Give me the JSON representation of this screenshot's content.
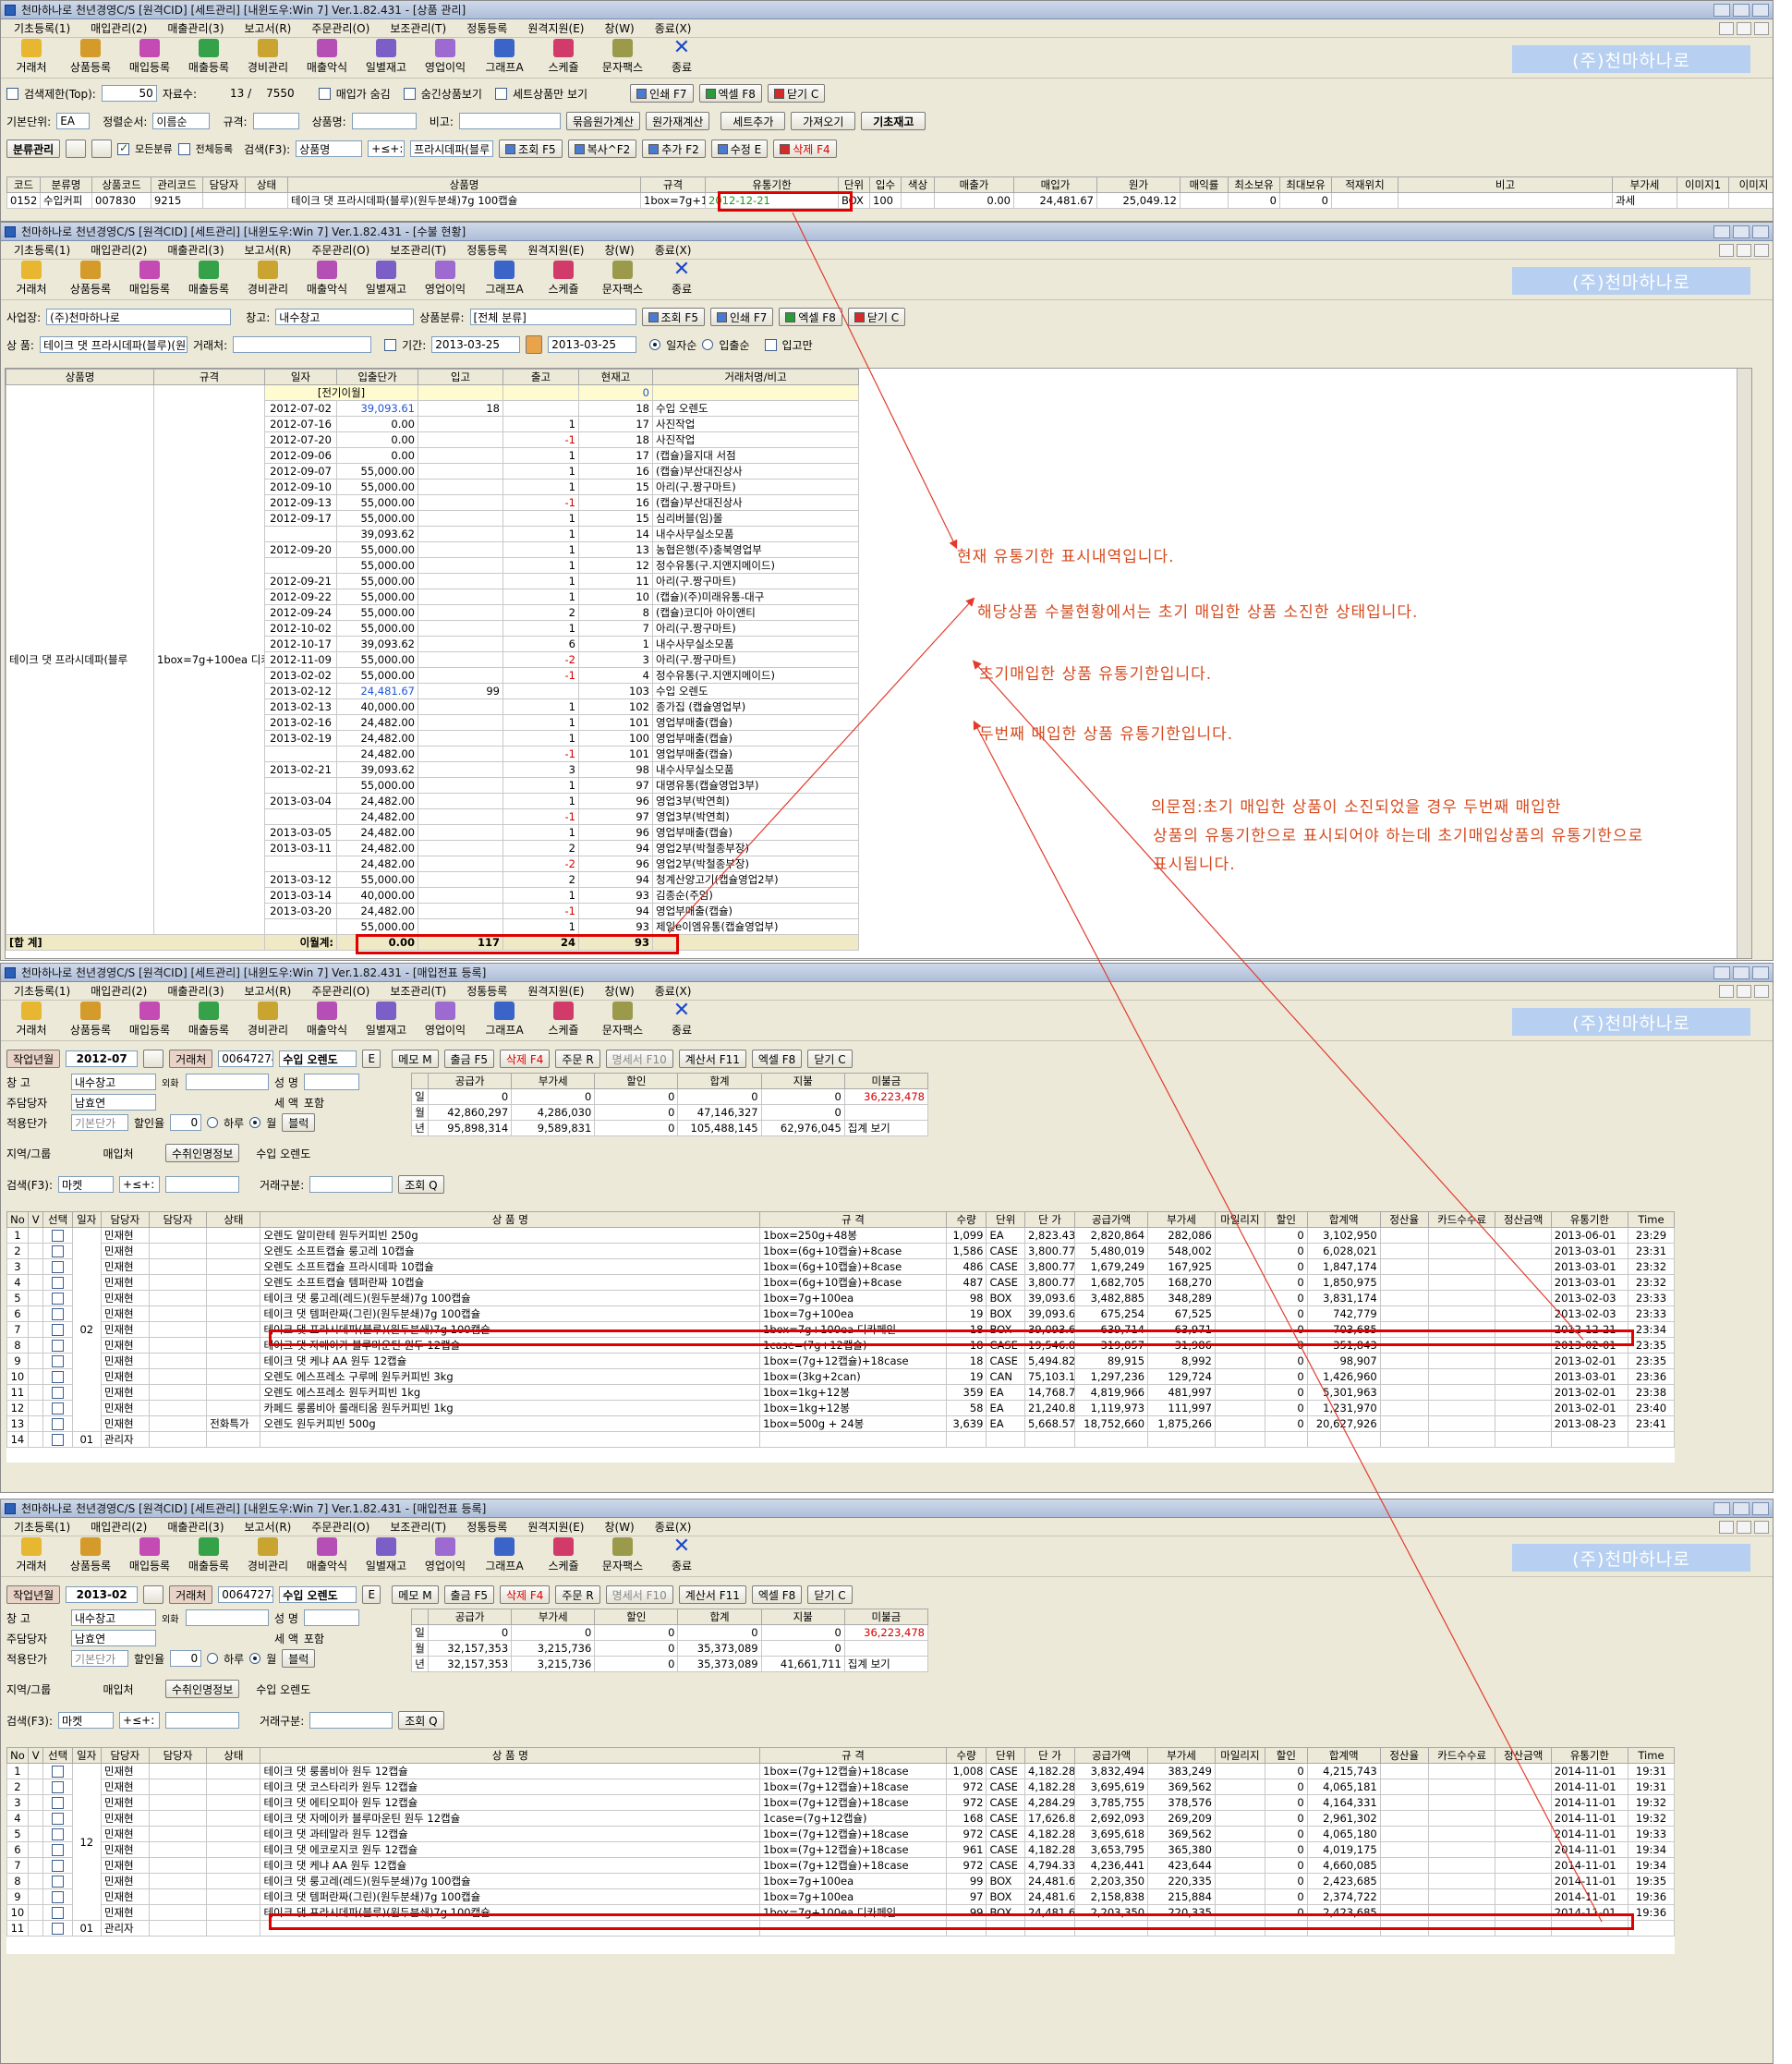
{
  "brand": "(주)천마하나로",
  "menu": [
    "기초등록(1)",
    "매입관리(2)",
    "매출관리(3)",
    "보고서(R)",
    "주문관리(O)",
    "보조관리(T)",
    "정통등록",
    "원격지원(E)",
    "창(W)",
    "종료(X)"
  ],
  "toolbar": [
    "거래처",
    "상품등록",
    "매입등록",
    "매출등록",
    "경비관리",
    "매출악식",
    "일별재고",
    "영업이익",
    "그래프A",
    "스케쥴",
    "문자팩스",
    "종료"
  ],
  "win1": {
    "title": "천마하나로 천년경영C/S [원격CID] [세트관리] [내윈도우:Win 7] Ver.1.82.431 - [상품 관리]",
    "search_limit_label": "검색제한(Top):",
    "search_limit": "50",
    "record_label": "자료수:",
    "record_count": "13 /",
    "record_total": "7550",
    "opt1": "매입가 숨김",
    "opt2": "숨긴상품보기",
    "opt3": "세트상품만 보기",
    "btn_print": "인쇄 F7",
    "btn_excel": "엑셀 F8",
    "btn_close": "닫기 C",
    "unit_label": "기본단위:",
    "unit": "EA",
    "sort_label": "정렬순서:",
    "sort": "이름순",
    "spec_label": "규격:",
    "name_label": "상품명:",
    "memo_label": "비고:",
    "btn_bulk_price": "묶음원가계산",
    "btn_cost_calc": "원가재계산",
    "btn_set_add": "세트추가",
    "btn_fetch": "가져오기",
    "btn_base_stock": "기초재고",
    "btn_category": "분류관리",
    "all_cat": "모든분류",
    "all_reg": "전체등록",
    "search_label": "검색(F3):",
    "search_field": "상품명",
    "search_op": "+≤+:",
    "search_value": "프라시데파(블루",
    "btn_query": "조회 F5",
    "btn_copy": "복사^F2",
    "btn_add": "추가 F2",
    "btn_edit": "수정 E",
    "btn_delete": "삭제 F4",
    "columns": [
      "코드",
      "분류명",
      "상품코드",
      "관리코드",
      "담당자",
      "상태",
      "상품명",
      "규격",
      "유통기한",
      "단위",
      "입수",
      "색상",
      "매출가",
      "매입가",
      "원가",
      "매익률",
      "최소보유",
      "최대보유",
      "적재위치",
      "비고",
      "부가세",
      "이미지1",
      "이미지"
    ],
    "row": [
      "0152",
      "수입커피",
      "007830",
      "9215",
      "",
      "",
      "테이크 댓 프라시데파(블루)(원두분쇄)7g 100캡슐",
      "1box=7g+100ea",
      "2012-12-21",
      "BOX",
      "100",
      "",
      "0.00",
      "24,481.67",
      "25,049.12",
      "",
      "0",
      "0",
      "",
      "",
      "과세",
      "",
      ""
    ]
  },
  "win2": {
    "title": "천마하나로 천년경영C/S [원격CID] [세트관리] [내윈도우:Win 7] Ver.1.82.431 - [수불 현황]",
    "biz_label": "사업장:",
    "biz": "(주)천마하나로",
    "wh_label": "창고:",
    "wh": "내수창고",
    "cat_label": "상품분류:",
    "cat": "[전체 분류]",
    "btn_query": "조회 F5",
    "btn_print": "인쇄 F7",
    "btn_excel": "엑셀 F8",
    "btn_close": "닫기 C",
    "prod_label": "상 품:",
    "prod": "테이크 댓 프라시데파(블루)(원두분",
    "vendor_label": "거래처:",
    "period_label": "기간:",
    "date_from": "2013-03-25",
    "date_to": "2013-03-25",
    "r1": "일자순",
    "r2": "입출순",
    "only_in": "입고만",
    "columns": [
      "상품명",
      "규격",
      "일자",
      "입출단가",
      "입고",
      "출고",
      "현재고",
      "거래처명/비고"
    ],
    "product_name": "테이크 댓 프라시데파(블루",
    "product_spec": "1box=7g+100ea 디카",
    "carry_label": "[전기이월]",
    "carry_value": "0",
    "rows": [
      [
        "2012-07-02",
        "39,093.61",
        "18",
        "",
        "18",
        "수입 오렌도"
      ],
      [
        "2012-07-16",
        "0.00",
        "",
        "1",
        "17",
        "사진작업"
      ],
      [
        "2012-07-20",
        "0.00",
        "",
        "-1",
        "18",
        "사진작업"
      ],
      [
        "2012-09-06",
        "0.00",
        "",
        "1",
        "17",
        "(캡슐)을지대 서점"
      ],
      [
        "2012-09-07",
        "55,000.00",
        "",
        "1",
        "16",
        "(캡슐)부산대진상사"
      ],
      [
        "2012-09-10",
        "55,000.00",
        "",
        "1",
        "15",
        "아리(구.짱구마트)"
      ],
      [
        "2012-09-13",
        "55,000.00",
        "",
        "-1",
        "16",
        "(캡슐)부산대진상사"
      ],
      [
        "2012-09-17",
        "55,000.00",
        "",
        "1",
        "15",
        "심리버블(임)몰"
      ],
      [
        "",
        "39,093.62",
        "",
        "1",
        "14",
        "내수사무실소모품"
      ],
      [
        "2012-09-20",
        "55,000.00",
        "",
        "1",
        "13",
        "농협은행(주)충북영업부"
      ],
      [
        "",
        "55,000.00",
        "",
        "1",
        "12",
        "정수유통(구.지앤지메이드)"
      ],
      [
        "2012-09-21",
        "55,000.00",
        "",
        "1",
        "11",
        "아리(구.짱구마트)"
      ],
      [
        "2012-09-22",
        "55,000.00",
        "",
        "1",
        "10",
        "(캡슐)(주)미래유통-대구"
      ],
      [
        "2012-09-24",
        "55,000.00",
        "",
        "2",
        "8",
        "(캡슐)코디아 아이앤티"
      ],
      [
        "2012-10-02",
        "55,000.00",
        "",
        "1",
        "7",
        "아리(구.짱구마트)"
      ],
      [
        "2012-10-17",
        "39,093.62",
        "",
        "6",
        "1",
        "내수사무실소모품"
      ],
      [
        "2012-11-09",
        "55,000.00",
        "",
        "-2",
        "3",
        "아리(구.짱구마트)"
      ],
      [
        "2013-02-02",
        "55,000.00",
        "",
        "-1",
        "4",
        "정수유통(구.지앤지메이드)"
      ],
      [
        "2013-02-12",
        "24,481.67",
        "99",
        "",
        "103",
        "수입 오렌도"
      ],
      [
        "2013-02-13",
        "40,000.00",
        "",
        "1",
        "102",
        "종가집 (캡슐영업부)"
      ],
      [
        "2013-02-16",
        "24,482.00",
        "",
        "1",
        "101",
        "영업부매출(캡슐)"
      ],
      [
        "2013-02-19",
        "24,482.00",
        "",
        "1",
        "100",
        "영업부매출(캡슐)"
      ],
      [
        "",
        "24,482.00",
        "",
        "-1",
        "101",
        "영업부매출(캡슐)"
      ],
      [
        "2013-02-21",
        "39,093.62",
        "",
        "3",
        "98",
        "내수사무실소모품"
      ],
      [
        "",
        "55,000.00",
        "",
        "1",
        "97",
        "대명유통(캡슐영업3부)"
      ],
      [
        "2013-03-04",
        "24,482.00",
        "",
        "1",
        "96",
        "영업3부(박연희)"
      ],
      [
        "",
        "24,482.00",
        "",
        "-1",
        "97",
        "영업3부(박연희)"
      ],
      [
        "2013-03-05",
        "24,482.00",
        "",
        "1",
        "96",
        "영업부매출(캡슐)"
      ],
      [
        "2013-03-11",
        "24,482.00",
        "",
        "2",
        "94",
        "영업2부(박철종부장)"
      ],
      [
        "",
        "24,482.00",
        "",
        "-2",
        "96",
        "영업2부(박철종부장)"
      ],
      [
        "2013-03-12",
        "55,000.00",
        "",
        "2",
        "94",
        "청계산양고기(캡슐영업2부)"
      ],
      [
        "2013-03-14",
        "40,000.00",
        "",
        "1",
        "93",
        "김종순(주임)"
      ],
      [
        "2013-03-20",
        "24,482.00",
        "",
        "-1",
        "94",
        "영업부매출(캡슐)"
      ],
      [
        "",
        "55,000.00",
        "",
        "1",
        "93",
        "제일e이엠유통(캡슐영업부)"
      ]
    ],
    "total_label": "[합 계]",
    "total_sub_label": "이월계:",
    "total_price": "0.00",
    "total_in": "117",
    "total_out": "24",
    "total_stock": "93"
  },
  "annotations": [
    "현재 유통기한 표시내역입니다.",
    "해당상품 수불현황에서는 초기 매입한 상품 소진한 상태입니다.",
    "초기매입한 상품 유통기한입니다.",
    "두번째 매입한 상품 유통기한입니다.",
    "의문점:초기 매입한 상품이 소진되었을 경우 두번째 매입한",
    "상품의 유통기한으로 표시되어야 하는데 초기매입상품의 유통기한으로",
    "표시됩니다."
  ],
  "win3": {
    "title": "천마하나로 천년경영C/S [원격CID] [세트관리] [내윈도우:Win 7] Ver.1.82.431 - [매입전표 등록]",
    "month_label": "작업년월",
    "month": "2012-07",
    "vendor_label": "거래처",
    "vendor_code": "00647274",
    "vendor_name": "수입 오렌도",
    "e_btn": "E",
    "btn_memo": "메모 M",
    "btn_out": "출금 F5",
    "btn_delete": "삭제 F4",
    "btn_order": "주문 R",
    "btn_stmt": "명세서 F10",
    "btn_bill": "계산서 F11",
    "btn_excel": "엑셀 F8",
    "btn_close": "닫기 C",
    "wh_label": "창 고",
    "wh": "내수창고",
    "staff_label": "주담당자",
    "staff": "남효연",
    "apply_label": "적용단가",
    "apply": "기본단가",
    "disc_label": "할인율",
    "disc": "0",
    "foreign": "외화",
    "name_lbl": "성 명",
    "tax_lbl": "세 액",
    "incl_lbl": "포함",
    "daily": "하루",
    "monthly": "월",
    "btn_block": "블럭",
    "sum_cols": [
      "공급가",
      "부가세",
      "할인",
      "합계",
      "지불",
      "미불금"
    ],
    "sum_rows": [
      {
        "k": "일",
        "v": [
          "0",
          "0",
          "0",
          "0",
          "0",
          ""
        ]
      },
      {
        "k": "월",
        "v": [
          "42,860,297",
          "4,286,030",
          "0",
          "47,146,327",
          "0",
          ""
        ]
      },
      {
        "k": "년",
        "v": [
          "95,898,314",
          "9,589,831",
          "0",
          "105,488,145",
          "62,976,045",
          "집계 보기"
        ]
      }
    ],
    "unpaid": "36,223,478",
    "region_label": "지역/그룹",
    "buyer_label": "매입처",
    "info_label": "수취인명정보",
    "info_value": "수입 오렌도",
    "search_label": "검색(F3):",
    "search_field": "마켓",
    "search_op": "+≤+:",
    "deal_label": "거래구분:",
    "btn_query": "조회 Q",
    "columns": [
      "No",
      "V",
      "선택",
      "일자",
      "담당자",
      "담당자",
      "상태",
      "상 품 명",
      "규 격",
      "수량",
      "단위",
      "단 가",
      "공급가액",
      "부가세",
      "마일리지",
      "할인",
      "합계액",
      "정산율",
      "카드수수료",
      "정산금액",
      "유통기한",
      "Time"
    ],
    "day": "02",
    "rows": [
      [
        "1",
        "민재현",
        "",
        "오렌도 알미란테 원두커피빈 250g",
        "1box=250g+48봉",
        "1,099",
        "EA",
        "2,823.43",
        "2,820,864",
        "282,086",
        "",
        "0",
        "3,102,950",
        "",
        "",
        "",
        "2013-06-01",
        "23:29"
      ],
      [
        "2",
        "민재현",
        "",
        "오렌도 소프트캡슐 룽고레 10캡슐",
        "1box=(6g+10캡슐)+8case",
        "1,586",
        "CASE",
        "3,800.77",
        "5,480,019",
        "548,002",
        "",
        "0",
        "6,028,021",
        "",
        "",
        "",
        "2013-03-01",
        "23:31"
      ],
      [
        "3",
        "민재현",
        "",
        "오렌도 소프트캡슐 프라시데파 10캡슐",
        "1box=(6g+10캡슐)+8case",
        "486",
        "CASE",
        "3,800.77",
        "1,679,249",
        "167,925",
        "",
        "0",
        "1,847,174",
        "",
        "",
        "",
        "2013-03-01",
        "23:32"
      ],
      [
        "4",
        "민재현",
        "",
        "오렌도 소프트캡슐 템퍼란짜 10캡슐",
        "1box=(6g+10캡슐)+8case",
        "487",
        "CASE",
        "3,800.77",
        "1,682,705",
        "168,270",
        "",
        "0",
        "1,850,975",
        "",
        "",
        "",
        "2013-03-01",
        "23:32"
      ],
      [
        "5",
        "민재현",
        "",
        "테이크 댓 룽고레(레드)(원두분쇄)7g 100캡슐",
        "1box=7g+100ea",
        "98",
        "BOX",
        "39,093.61",
        "3,482,885",
        "348,289",
        "",
        "0",
        "3,831,174",
        "",
        "",
        "",
        "2013-02-03",
        "23:33"
      ],
      [
        "6",
        "민재현",
        "",
        "테이크 댓 템퍼란짜(그린)(원두분쇄)7g 100캡슐",
        "1box=7g+100ea",
        "19",
        "BOX",
        "39,093.61",
        "675,254",
        "67,525",
        "",
        "0",
        "742,779",
        "",
        "",
        "",
        "2013-02-03",
        "23:33"
      ],
      [
        "7",
        "민재현",
        "",
        "테이크 댓 프라시데파(블루)(원두분쇄)7g 100캡슐",
        "1box=7g+100ea 디카페인",
        "18",
        "BOX",
        "39,093.61",
        "639,714",
        "63,971",
        "",
        "0",
        "703,685",
        "",
        "",
        "",
        "2012-12-21",
        "23:34"
      ],
      [
        "8",
        "민재현",
        "",
        "테이크 댓 자메이카 블루마운틴 원두 12캡슐",
        "1case=(7g+12캡슐)",
        "18",
        "CASE",
        "19,546.81",
        "319,857",
        "31,986",
        "",
        "0",
        "351,843",
        "",
        "",
        "",
        "2013-02-01",
        "23:35"
      ],
      [
        "9",
        "민재현",
        "",
        "테이크 댓 케냐 AA 원두 12캡슐",
        "1box=(7g+12캡슐)+18case",
        "18",
        "CASE",
        "5,494.82",
        "89,915",
        "8,992",
        "",
        "0",
        "98,907",
        "",
        "",
        "",
        "2013-02-01",
        "23:35"
      ],
      [
        "10",
        "민재현",
        "",
        "오렌도 에스프레소 구루메 원두커피빈 3kg",
        "1box=(3kg+2can)",
        "19",
        "CAN",
        "75,103.17",
        "1,297,236",
        "129,724",
        "",
        "0",
        "1,426,960",
        "",
        "",
        "",
        "2013-03-01",
        "23:36"
      ],
      [
        "11",
        "민재현",
        "",
        "오렌도 에스프레소 원두커피빈 1kg",
        "1box=1kg+12봉",
        "359",
        "EA",
        "14,768.70",
        "4,819,966",
        "481,997",
        "",
        "0",
        "5,301,963",
        "",
        "",
        "",
        "2013-02-01",
        "23:38"
      ],
      [
        "12",
        "민재현",
        "",
        "카페드 룽롬비아 룰래티움 원두커피빈 1kg",
        "1box=1kg+12봉",
        "58",
        "EA",
        "21,240.86",
        "1,119,973",
        "111,997",
        "",
        "0",
        "1,231,970",
        "",
        "",
        "",
        "2013-02-01",
        "23:40"
      ],
      [
        "13",
        "민재현",
        "전화특가",
        "오렌도 원두커피빈 500g",
        "1box=500g + 24봉",
        "3,639",
        "EA",
        "5,668.57",
        "18,752,660",
        "1,875,266",
        "",
        "0",
        "20,627,926",
        "",
        "",
        "",
        "2013-08-23",
        "23:41"
      ]
    ],
    "row14": [
      "14",
      "01",
      "관리자"
    ]
  },
  "win4": {
    "title": "천마하나로 천년경영C/S [원격CID] [세트관리] [내윈도우:Win 7] Ver.1.82.431 - [매입전표 등록]",
    "month": "2013-02",
    "vendor_code": "00647274",
    "vendor_name": "수입 오렌도",
    "sum_rows": [
      {
        "k": "일",
        "v": [
          "0",
          "0",
          "0",
          "0",
          "0",
          ""
        ]
      },
      {
        "k": "월",
        "v": [
          "32,157,353",
          "3,215,736",
          "0",
          "35,373,089",
          "0",
          ""
        ]
      },
      {
        "k": "년",
        "v": [
          "32,157,353",
          "3,215,736",
          "0",
          "35,373,089",
          "41,661,711",
          "집계 보기"
        ]
      }
    ],
    "unpaid": "36,223,478",
    "day": "12",
    "rows": [
      [
        "1",
        "민재현",
        "",
        "테이크 댓 룽롬비아 원두 12캡슐",
        "1box=(7g+12캡슐)+18case",
        "1,008",
        "CASE",
        "4,182.28",
        "3,832,494",
        "383,249",
        "",
        "0",
        "4,215,743",
        "",
        "",
        "",
        "2014-11-01",
        "19:31"
      ],
      [
        "2",
        "민재현",
        "",
        "테이크 댓 코스타리카 원두 12캡슐",
        "1box=(7g+12캡슐)+18case",
        "972",
        "CASE",
        "4,182.28",
        "3,695,619",
        "369,562",
        "",
        "0",
        "4,065,181",
        "",
        "",
        "",
        "2014-11-01",
        "19:31"
      ],
      [
        "3",
        "민재현",
        "",
        "테이크 댓 에티오피아 원두 12캡슐",
        "1box=(7g+12캡슐)+18case",
        "972",
        "CASE",
        "4,284.29",
        "3,785,755",
        "378,576",
        "",
        "0",
        "4,164,331",
        "",
        "",
        "",
        "2014-11-01",
        "19:32"
      ],
      [
        "4",
        "민재현",
        "",
        "테이크 댓 자메이카 블루마운틴 원두 12캡슐",
        "1case=(7g+12캡슐)",
        "168",
        "CASE",
        "17,626.80",
        "2,692,093",
        "269,209",
        "",
        "0",
        "2,961,302",
        "",
        "",
        "",
        "2014-11-01",
        "19:32"
      ],
      [
        "5",
        "민재현",
        "",
        "테이크 댓 과테말라 원두 12캡슐",
        "1box=(7g+12캡슐)+18case",
        "972",
        "CASE",
        "4,182.28",
        "3,695,618",
        "369,562",
        "",
        "0",
        "4,065,180",
        "",
        "",
        "",
        "2014-11-01",
        "19:33"
      ],
      [
        "6",
        "민재현",
        "",
        "테이크 댓 에코로지코 원두 12캡슐",
        "1box=(7g+12캡슐)+18case",
        "961",
        "CASE",
        "4,182.28",
        "3,653,795",
        "365,380",
        "",
        "0",
        "4,019,175",
        "",
        "",
        "",
        "2014-11-01",
        "19:34"
      ],
      [
        "7",
        "민재현",
        "",
        "테이크 댓 케냐 AA 원두 12캡슐",
        "1box=(7g+12캡슐)+18case",
        "972",
        "CASE",
        "4,794.33",
        "4,236,441",
        "423,644",
        "",
        "0",
        "4,660,085",
        "",
        "",
        "",
        "2014-11-01",
        "19:34"
      ],
      [
        "8",
        "민재현",
        "",
        "테이크 댓 룽고레(레드)(원두분쇄)7g 100캡슐",
        "1box=7g+100ea",
        "99",
        "BOX",
        "24,481.67",
        "2,203,350",
        "220,335",
        "",
        "0",
        "2,423,685",
        "",
        "",
        "",
        "2014-11-01",
        "19:35"
      ],
      [
        "9",
        "민재현",
        "",
        "테이크 댓 템퍼란짜(그린)(원두분쇄)7g 100캡슐",
        "1box=7g+100ea",
        "97",
        "BOX",
        "24,481.67",
        "2,158,838",
        "215,884",
        "",
        "0",
        "2,374,722",
        "",
        "",
        "",
        "2014-11-01",
        "19:36"
      ],
      [
        "10",
        "민재현",
        "",
        "테이크 댓 프라시데파(블루)(원두분쇄)7g 100캡슐",
        "1box=7g+100ea 디카페인",
        "99",
        "BOX",
        "24,481.67",
        "2,203,350",
        "220,335",
        "",
        "0",
        "2,423,685",
        "",
        "",
        "",
        "2014-11-01",
        "19:36"
      ]
    ],
    "row11": [
      "11",
      "01",
      "관리자"
    ]
  }
}
